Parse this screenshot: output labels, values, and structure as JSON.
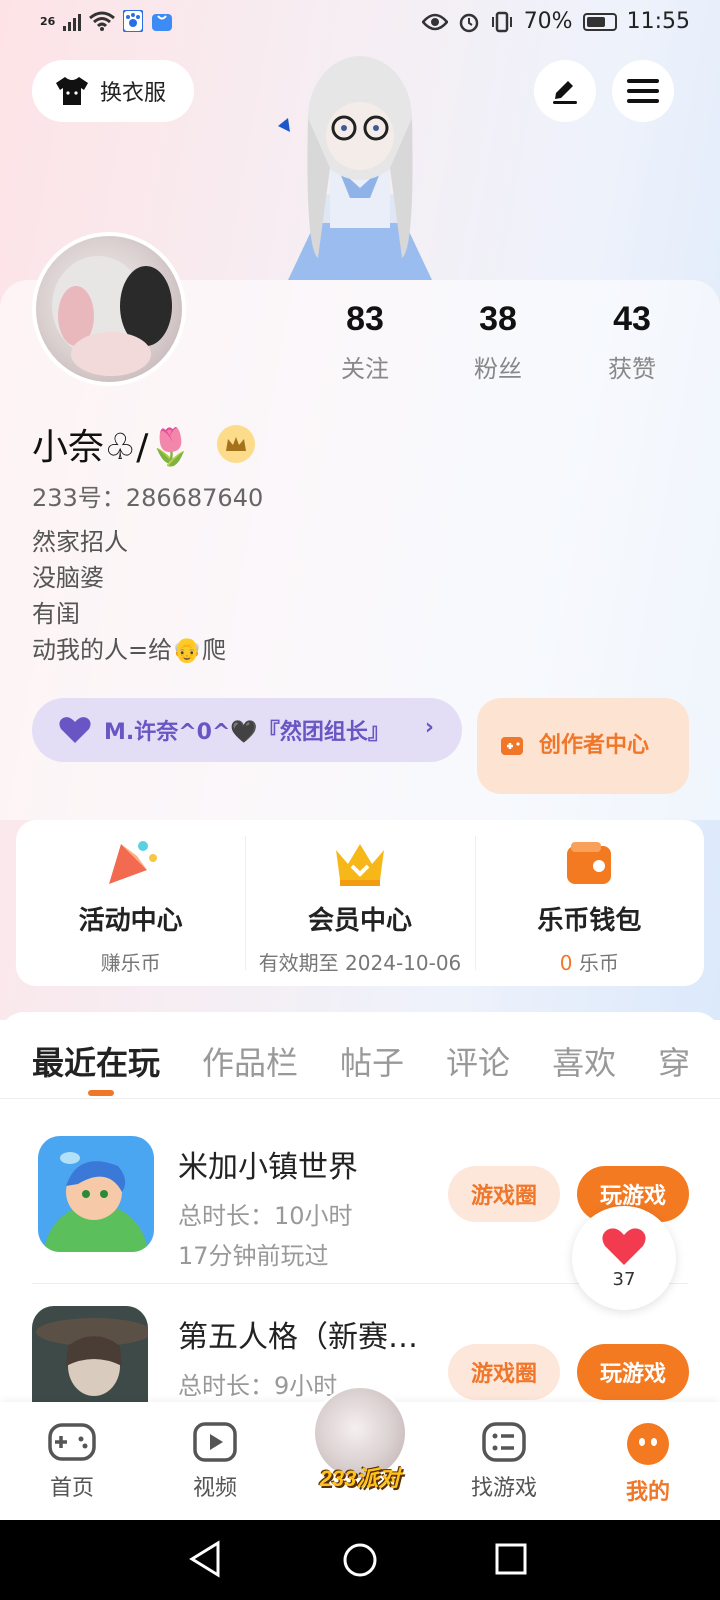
{
  "status_bar": {
    "network": "26",
    "battery": "70%",
    "time": "11:55"
  },
  "header": {
    "outfit_label": "换衣服"
  },
  "profile": {
    "stats": [
      {
        "num": "83",
        "label": "关注"
      },
      {
        "num": "38",
        "label": "粉丝"
      },
      {
        "num": "43",
        "label": "获赞"
      }
    ],
    "name": "小奈♧/🌷",
    "uid": "233号：286687640",
    "bio": [
      "然家招人",
      "没脑婆",
      "有闺",
      "动我的人=给👴爬"
    ],
    "team_label": "M.许奈^0^🖤『然团组长』",
    "creator_label": "创作者中心"
  },
  "quick": [
    {
      "title": "活动中心",
      "sub": "赚乐币"
    },
    {
      "title": "会员中心",
      "sub": "有效期至 2024-10-06"
    },
    {
      "title": "乐币钱包",
      "sub_num": "0",
      "sub_unit": " 乐币"
    }
  ],
  "tabs": [
    "最近在玩",
    "作品栏",
    "帖子",
    "评论",
    "喜欢",
    "穿"
  ],
  "games": [
    {
      "name": "米加小镇世界",
      "duration": "总时长：10小时",
      "last": "17分钟前玩过",
      "circle": "游戏圈",
      "play": "玩游戏"
    },
    {
      "name": "第五人格（新赛…",
      "duration": "总时长：9小时",
      "circle": "游戏圈",
      "play": "玩游戏"
    }
  ],
  "like_count": "37",
  "bottom_nav": {
    "home": "首页",
    "video": "视频",
    "party": "233派对",
    "find": "找游戏",
    "mine": "我的"
  },
  "colors": {
    "accent": "#f0772a",
    "purple": "#6a55c4"
  }
}
